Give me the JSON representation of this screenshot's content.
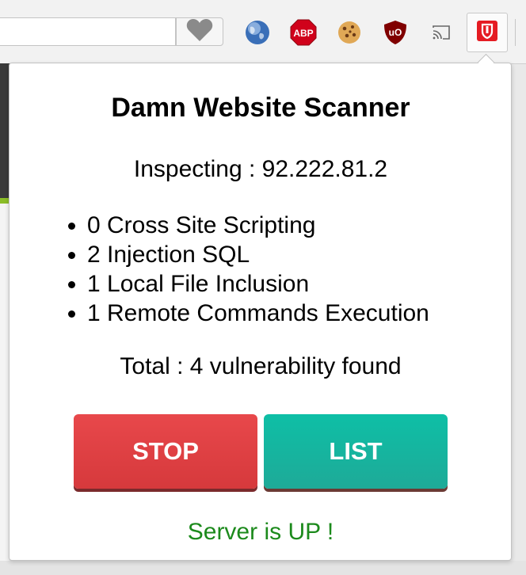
{
  "popup": {
    "title": "Damn Website Scanner",
    "inspecting": "Inspecting : 92.222.81.2",
    "vulnerabilities": [
      "0 Cross Site Scripting",
      "2 Injection SQL",
      "1 Local File Inclusion",
      "1 Remote Commands Execution"
    ],
    "total": "Total : 4 vulnerability found",
    "buttons": {
      "stop": "STOP",
      "list": "LIST"
    },
    "status": "Server is UP !"
  },
  "toolbar": {
    "extensions": [
      {
        "icon": "globe-icon"
      },
      {
        "icon": "adblock-plus-icon",
        "text": "ABP"
      },
      {
        "icon": "cookie-icon"
      },
      {
        "icon": "ublock-origin-icon",
        "text": "uO"
      },
      {
        "icon": "cast-icon"
      },
      {
        "icon": "damn-scanner-icon"
      }
    ]
  },
  "colors": {
    "stop_button": "#e04446",
    "list_button": "#13b3a0",
    "status_text": "#1c8a1c",
    "abp_red": "#d0021b"
  }
}
